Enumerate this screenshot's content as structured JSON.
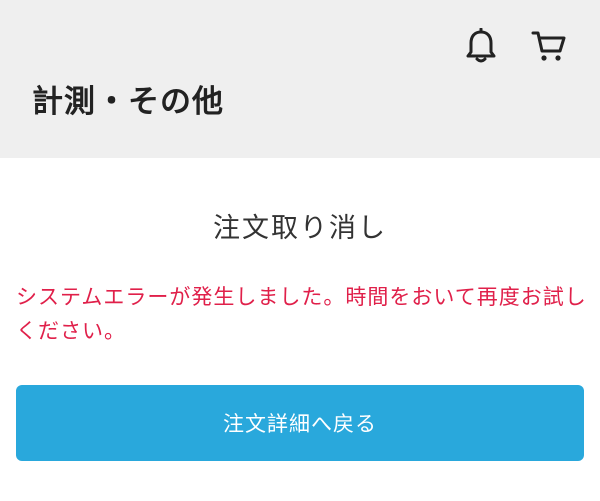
{
  "header": {
    "title": "計測・その他",
    "icons": {
      "notifications": "bell-icon",
      "cart": "cart-icon"
    }
  },
  "dialog": {
    "title": "注文取り消し",
    "error_message": "システムエラーが発生しました。時間をおいて再度お試しください。",
    "back_button_label": "注文詳細へ戻る"
  },
  "colors": {
    "header_bg": "#efefef",
    "error_text": "#e0204a",
    "button_bg": "#29a8dc",
    "button_text": "#ffffff"
  }
}
